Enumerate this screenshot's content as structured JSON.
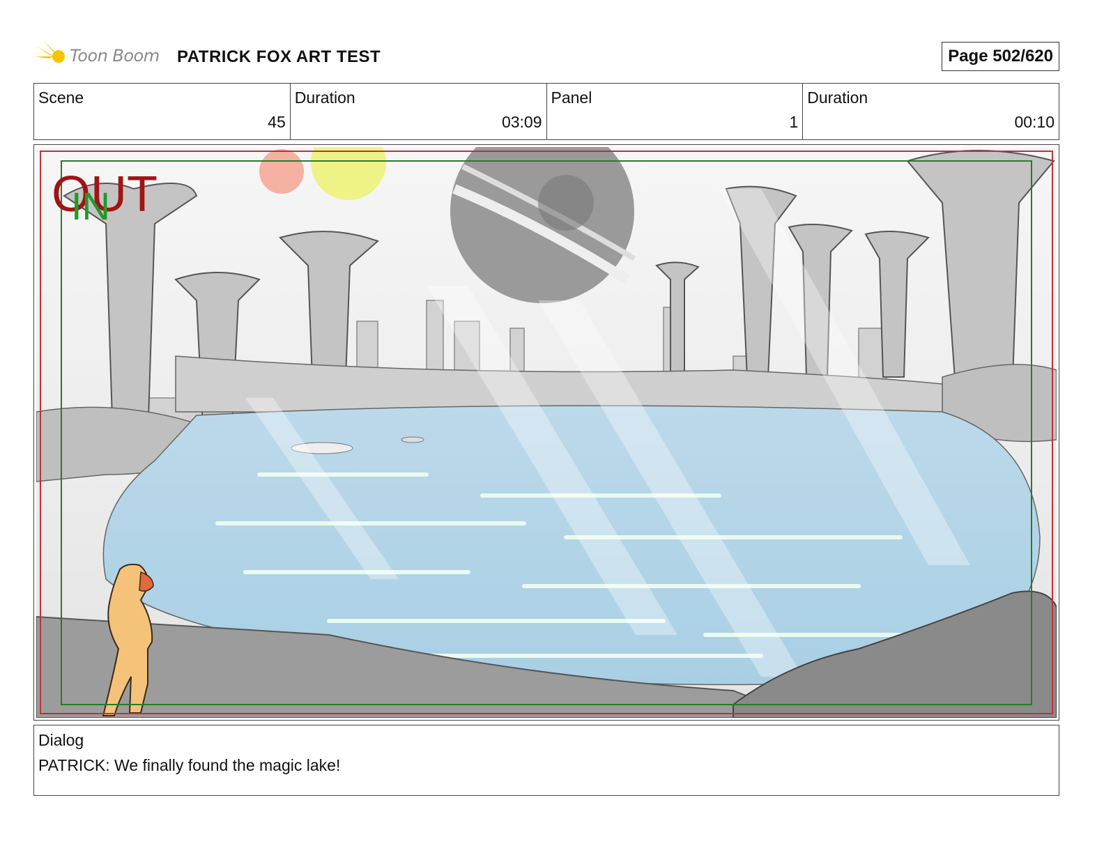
{
  "header": {
    "logo_text": "Toon Boom",
    "title": "PATRICK FOX ART TEST",
    "page": "Page 502/620"
  },
  "info": {
    "scene_label": "Scene",
    "scene_value": "45",
    "scene_duration_label": "Duration",
    "scene_duration_value": "03:09",
    "panel_label": "Panel",
    "panel_value": "1",
    "panel_duration_label": "Duration",
    "panel_duration_value": "00:10"
  },
  "panel": {
    "out_marker": "OUT",
    "in_marker": "IN"
  },
  "dialog": {
    "label": "Dialog",
    "text": "PATRICK: We finally found the magic lake!"
  },
  "colors": {
    "out_marker": "#a01414",
    "in_marker": "#1f9a2a",
    "safe_frame_red": "#c0303a",
    "safe_frame_green": "#2a7a2a",
    "water": "#b8d8e8"
  }
}
